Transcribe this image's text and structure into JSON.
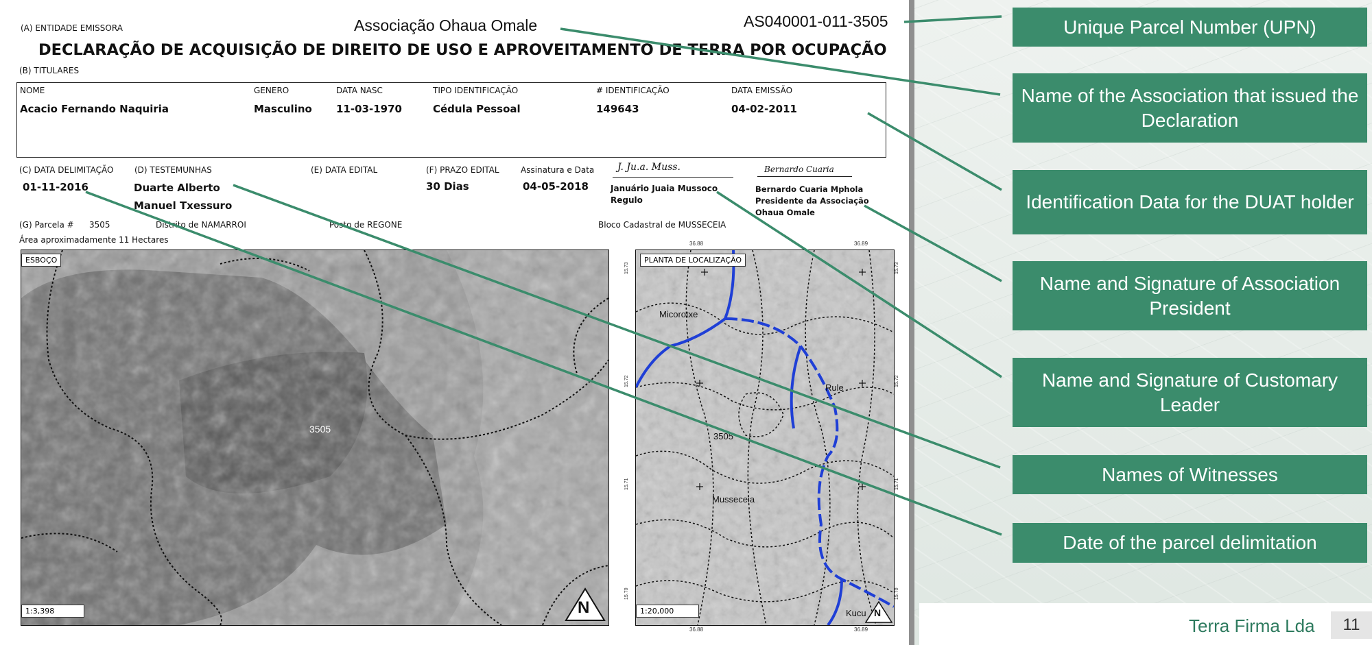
{
  "document": {
    "entity_label": "(A) ENTIDADE EMISSORA",
    "association_name": "Associação Ohaua Omale",
    "upn": "AS040001-011-3505",
    "title": "DECLARAÇÃO DE ACQUISIÇÃO DE DIREITO DE USO E APROVEITAMENTO DE TERRA POR OCUPAÇÃO",
    "holders_label": "(B) TITULARES",
    "holder_headers": [
      "NOME",
      "GENERO",
      "DATA NASC",
      "TIPO IDENTIFICAÇÃO",
      "# IDENTIFICAÇÃO",
      "DATA EMISSÃO"
    ],
    "holder_values": [
      "Acacio Fernando Naquiria",
      "Masculino",
      "11-03-1970",
      "Cédula Pessoal",
      "149643",
      "04-02-2011"
    ],
    "delimitation_label": "(C) DATA DELIMITAÇÃO",
    "delimitation_date": "01-11-2016",
    "witnesses_label": "(D) TESTEMUNHAS",
    "witness_1": "Duarte Alberto",
    "witness_2": "Manuel Txessuro",
    "edital_label": "(E) DATA EDITAL",
    "prazo_label": "(F) PRAZO EDITAL",
    "prazo_value": "30 Dias",
    "signature_label": "Assinatura e Data",
    "signature_date": "04-05-2018",
    "leader_signature": "J. Ju.a. Muss.",
    "leader_name": "Januário Juaia Mussoco",
    "leader_role": "Regulo",
    "president_signature": "Bernardo Cuaria",
    "president_name": "Bernardo Cuaria Mphola",
    "president_role": "Presidente da Associação",
    "president_assoc": "Ohaua Omale",
    "parcel_label": "(G) Parcela #",
    "parcel_number": "3505",
    "district": "Distrito de NAMARROI",
    "posto": "Posto de REGONE",
    "bloco": "Bloco Cadastral de MUSSECEIA",
    "area": "Área aproximadamente 11 Hectares",
    "sketch_label": "ESBOÇO",
    "sketch_parcel": "3505",
    "sketch_scale": "1:3,398",
    "north": "N",
    "location_label": "PLANTA DE LOCALIZAÇÃO",
    "location_scale": "1:20,000",
    "loc_parcel": "3505",
    "loc_places": [
      "Micorotxe",
      "Rule",
      "Musseceia",
      "Kucu"
    ],
    "loc_ticks_top": [
      "36.88",
      "36.89"
    ],
    "loc_ticks_bottom": [
      "36.88",
      "36.89"
    ],
    "loc_ticks_left": [
      "15.70",
      "15.71",
      "15.72",
      "15.73"
    ],
    "loc_ticks_right": [
      "15.70",
      "15.71",
      "15.72",
      "15.73"
    ]
  },
  "callouts": [
    "Unique Parcel Number (UPN)",
    "Name of the Association that issued the Declaration",
    "Identification Data for the DUAT holder",
    "Name and Signature of Association President",
    "Name and Signature of Customary Leader",
    "Names of Witnesses",
    "Date of the parcel delimitation"
  ],
  "footer": {
    "company": "Terra Firma Lda",
    "page": "11"
  },
  "colors": {
    "callout_bg": "#3b8c6c",
    "leader_line": "#3b8c6c",
    "road": "#1f3fd6"
  }
}
